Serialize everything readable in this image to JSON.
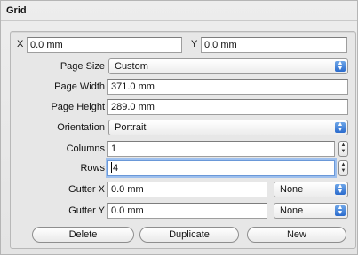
{
  "window": {
    "title": "Grid"
  },
  "form": {
    "x": {
      "label": "X",
      "value": "0.0 mm"
    },
    "y": {
      "label": "Y",
      "value": "0.0 mm"
    },
    "page_size": {
      "label": "Page Size",
      "value": "Custom"
    },
    "page_width": {
      "label": "Page Width",
      "value": "371.0 mm"
    },
    "page_height": {
      "label": "Page Height",
      "value": "289.0 mm"
    },
    "orientation": {
      "label": "Orientation",
      "value": "Portrait"
    },
    "columns": {
      "label": "Columns",
      "value": "1"
    },
    "rows": {
      "label": "Rows",
      "value": "4"
    },
    "gutter_x": {
      "label": "Gutter X",
      "value": "0.0 mm",
      "mode": "None"
    },
    "gutter_y": {
      "label": "Gutter Y",
      "value": "0.0 mm",
      "mode": "None"
    }
  },
  "buttons": {
    "delete": "Delete",
    "duplicate": "Duplicate",
    "new": "New"
  },
  "icons": {
    "popup_arrows": "up-down-arrows-icon",
    "stepper": "stepper-icon"
  }
}
